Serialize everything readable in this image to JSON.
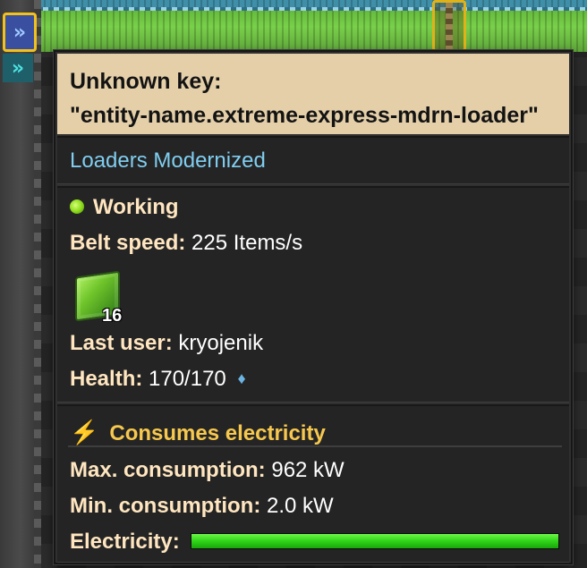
{
  "tooltip": {
    "title_line1": "Unknown key:",
    "title_line2": "\"entity-name.extreme-express-mdrn-loader\"",
    "mod_name": "Loaders Modernized",
    "status": "Working",
    "belt_speed_label": "Belt speed:",
    "belt_speed_value": "225 Items/s",
    "item_count": "16",
    "last_user_label": "Last user:",
    "last_user_value": "kryojenik",
    "health_label": "Health:",
    "health_value": "170/170",
    "health_icon": "diamond-icon",
    "energy_header": "Consumes electricity",
    "energy_icon": "lightning-icon",
    "max_consumption_label": "Max. consumption:",
    "max_consumption_value": "962 kW",
    "min_consumption_label": "Min. consumption:",
    "min_consumption_value": "2.0 kW",
    "electricity_label": "Electricity:",
    "electricity_fill": 1.0
  },
  "colors": {
    "header_bg": "#e4cfa9",
    "mod_name": "#80cef0",
    "label": "#ffe6c0",
    "energy": "#f6c84e",
    "status_green": "#8fdc1c",
    "bar_fill": "#2fd418"
  }
}
